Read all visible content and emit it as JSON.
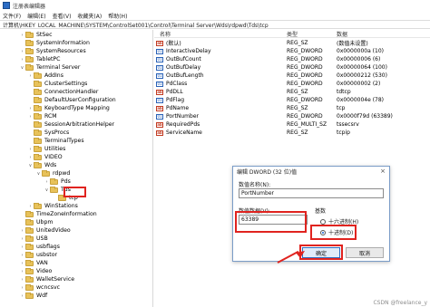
{
  "window": {
    "title": "注册表编辑器"
  },
  "menu": [
    "文件(F)",
    "编辑(E)",
    "查看(V)",
    "收藏夹(A)",
    "帮助(H)"
  ],
  "address": "计算机\\HKEY_LOCAL_MACHINE\\SYSTEM\\ControlSet001\\Control\\Terminal Server\\Wds\\rdpwd\\Tds\\tcp",
  "tree": [
    {
      "label": "StSec",
      "indent": 1,
      "expander": ">"
    },
    {
      "label": "SystemInformation",
      "indent": 1,
      "expander": ""
    },
    {
      "label": "SystemResources",
      "indent": 1,
      "expander": ">"
    },
    {
      "label": "TabletPC",
      "indent": 1,
      "expander": ">"
    },
    {
      "label": "Terminal Server",
      "indent": 1,
      "expander": "v"
    },
    {
      "label": "AddIns",
      "indent": 2,
      "expander": ">"
    },
    {
      "label": "ClusterSettings",
      "indent": 2,
      "expander": ""
    },
    {
      "label": "ConnectionHandler",
      "indent": 2,
      "expander": ""
    },
    {
      "label": "DefaultUserConfiguration",
      "indent": 2,
      "expander": ""
    },
    {
      "label": "KeyboardType Mapping",
      "indent": 2,
      "expander": ">"
    },
    {
      "label": "RCM",
      "indent": 2,
      "expander": ">"
    },
    {
      "label": "SessionArbitrationHelper",
      "indent": 2,
      "expander": ""
    },
    {
      "label": "SysProcs",
      "indent": 2,
      "expander": ""
    },
    {
      "label": "TerminalTypes",
      "indent": 2,
      "expander": ""
    },
    {
      "label": "Utilities",
      "indent": 2,
      "expander": ">"
    },
    {
      "label": "VIDEO",
      "indent": 2,
      "expander": ">"
    },
    {
      "label": "Wds",
      "indent": 2,
      "expander": "v"
    },
    {
      "label": "rdpwd",
      "indent": 3,
      "expander": "v"
    },
    {
      "label": "Pds",
      "indent": 4,
      "expander": ">"
    },
    {
      "label": "Tds",
      "indent": 4,
      "expander": "v"
    },
    {
      "label": "tcp",
      "indent": 5,
      "expander": ""
    },
    {
      "label": "WinStations",
      "indent": 2,
      "expander": ">"
    },
    {
      "label": "TimeZoneInformation",
      "indent": 1,
      "expander": ""
    },
    {
      "label": "Ubpm",
      "indent": 1,
      "expander": ""
    },
    {
      "label": "UnitedVideo",
      "indent": 1,
      "expander": ">"
    },
    {
      "label": "USB",
      "indent": 1,
      "expander": ">"
    },
    {
      "label": "usbflags",
      "indent": 1,
      "expander": ">"
    },
    {
      "label": "usbstor",
      "indent": 1,
      "expander": ">"
    },
    {
      "label": "VAN",
      "indent": 1,
      "expander": ">"
    },
    {
      "label": "Video",
      "indent": 1,
      "expander": ">"
    },
    {
      "label": "WalletService",
      "indent": 1,
      "expander": ">"
    },
    {
      "label": "wcncsvc",
      "indent": 1,
      "expander": ">"
    },
    {
      "label": "Wdf",
      "indent": 1,
      "expander": ">"
    }
  ],
  "columns": {
    "name": "名称",
    "type": "类型",
    "data": "数据"
  },
  "values": [
    {
      "name": "(默认)",
      "type": "REG_SZ",
      "data": "(数值未设置)",
      "kind": "str"
    },
    {
      "name": "InteractiveDelay",
      "type": "REG_DWORD",
      "data": "0x0000000a (10)",
      "kind": "bin"
    },
    {
      "name": "OutBufCount",
      "type": "REG_DWORD",
      "data": "0x00000006 (6)",
      "kind": "bin"
    },
    {
      "name": "OutBufDelay",
      "type": "REG_DWORD",
      "data": "0x00000064 (100)",
      "kind": "bin"
    },
    {
      "name": "OutBufLength",
      "type": "REG_DWORD",
      "data": "0x00000212 (530)",
      "kind": "bin"
    },
    {
      "name": "PdClass",
      "type": "REG_DWORD",
      "data": "0x00000002 (2)",
      "kind": "bin"
    },
    {
      "name": "PdDLL",
      "type": "REG_SZ",
      "data": "tdtcp",
      "kind": "str"
    },
    {
      "name": "PdFlag",
      "type": "REG_DWORD",
      "data": "0x0000004e (78)",
      "kind": "bin"
    },
    {
      "name": "PdName",
      "type": "REG_SZ",
      "data": "tcp",
      "kind": "str"
    },
    {
      "name": "PortNumber",
      "type": "REG_DWORD",
      "data": "0x0000f79d (63389)",
      "kind": "bin"
    },
    {
      "name": "RequiredPds",
      "type": "REG_MULTI_SZ",
      "data": "tssecsrv",
      "kind": "str"
    },
    {
      "name": "ServiceName",
      "type": "REG_SZ",
      "data": "tcpip",
      "kind": "str"
    }
  ],
  "dialog": {
    "title": "编辑 DWORD (32 位)值",
    "close": "×",
    "name_label": "数值名称(N):",
    "name_value": "PortNumber",
    "data_label": "数值数据(V):",
    "data_value": "63389",
    "base_label": "基数",
    "radio_hex": "十六进制(H)",
    "radio_dec": "十进制(D)",
    "selected_base": "decimal",
    "ok": "确定",
    "cancel": "取消"
  },
  "watermark": "CSDN @freelance_y"
}
